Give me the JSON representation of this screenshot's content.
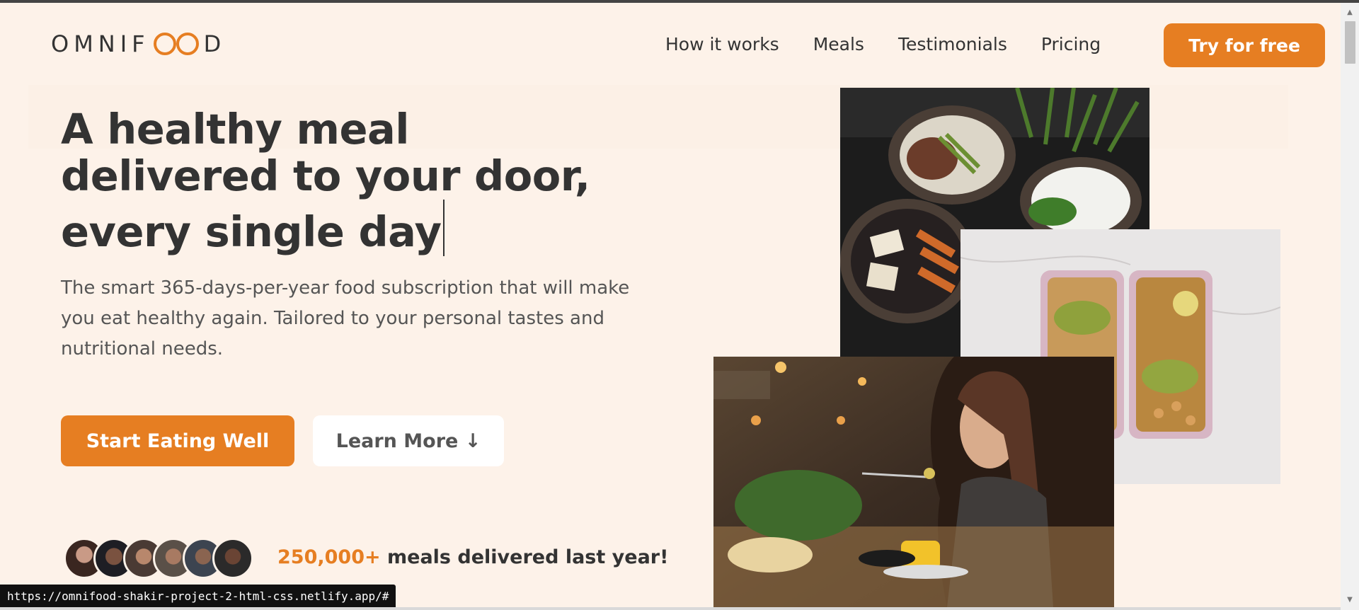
{
  "header": {
    "logo_text_left": "OMNIF",
    "logo_text_right": "D",
    "nav": [
      {
        "label": "How it works"
      },
      {
        "label": "Meals"
      },
      {
        "label": "Testimonials"
      },
      {
        "label": "Pricing"
      }
    ],
    "cta_label": "Try for free"
  },
  "hero": {
    "headline_line1": "A healthy meal",
    "headline_line2": "delivered to your door,",
    "headline_line3": "every single day",
    "description": "The smart 365-days-per-year food subscription that will make you eat healthy again. Tailored to your personal tastes and nutritional needs.",
    "primary_button": "Start Eating Well",
    "secondary_button": "Learn More ↓",
    "delivered_highlight": "250,000+",
    "delivered_text": " meals delivered last year!"
  },
  "status_bar": {
    "url": "https://omnifood-shakir-project-2-html-css.netlify.app/#"
  },
  "colors": {
    "brand": "#e67e22",
    "background": "#fdf2e9",
    "text": "#333333"
  },
  "icons": [
    "logo-infinity-icon",
    "scroll-up-arrow-icon",
    "scroll-down-arrow-icon"
  ]
}
